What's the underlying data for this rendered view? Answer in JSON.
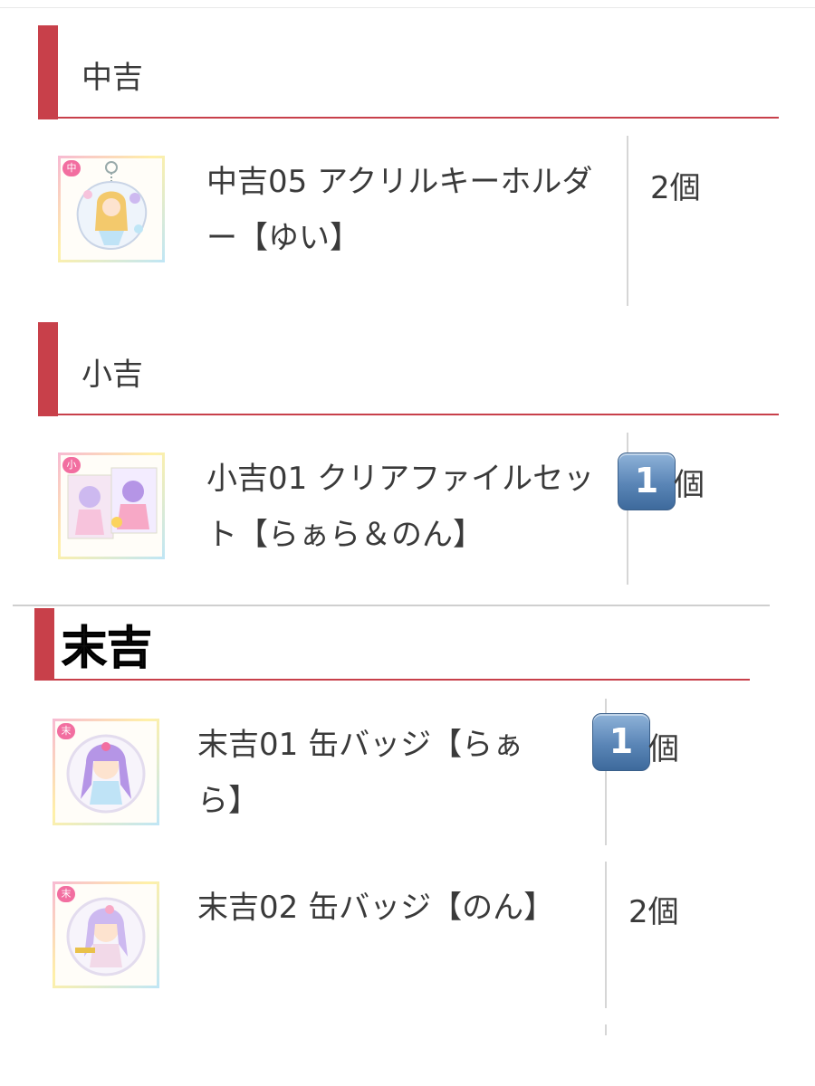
{
  "sections": [
    {
      "title": "中吉",
      "items": [
        {
          "name": "中吉05 アクリルキーホルダー【ゆい】",
          "qty_number": "2",
          "qty_unit": "個",
          "badge_icon": "中"
        }
      ]
    },
    {
      "title": "小吉",
      "items": [
        {
          "name": "小吉01 クリアファイルセット【らぁら＆のん】",
          "qty_number": "1",
          "qty_unit": "個",
          "badge_icon": "小"
        }
      ]
    },
    {
      "title": "末吉",
      "items": [
        {
          "name": "末吉01 缶バッジ【らぁら】",
          "qty_number": "1",
          "qty_unit": "個",
          "badge_icon": "末"
        },
        {
          "name": "末吉02 缶バッジ【のん】",
          "qty_number": "2",
          "qty_unit": "個",
          "badge_icon": "末"
        }
      ]
    }
  ],
  "colors": {
    "accent": "#c8404a",
    "keycap_badge": "#5a85b6",
    "divider": "#d6d6d6"
  }
}
